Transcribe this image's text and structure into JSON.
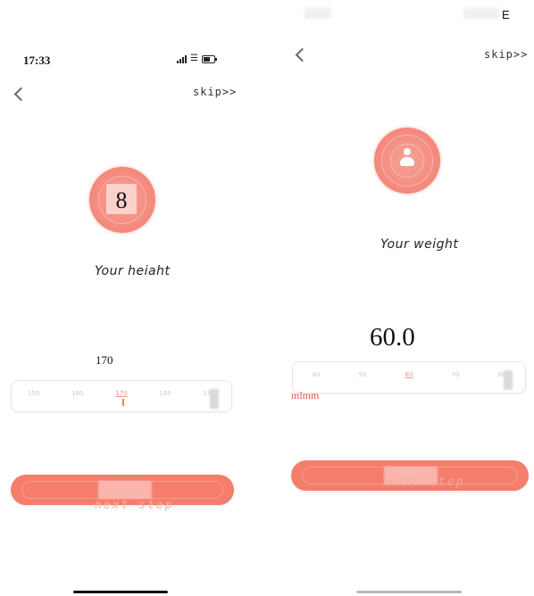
{
  "colors": {
    "accent": "#f47d6b",
    "accent_light": "#f6a49a",
    "unit_text": "#e9574a"
  },
  "left": {
    "status_bar": {
      "time": "17:33",
      "icons": [
        "signal-icon",
        "wifi-icon",
        "battery-icon"
      ]
    },
    "nav": {
      "back_icon": "chevron-left-icon",
      "skip_label": "skip>>"
    },
    "avatar_glyph": "8",
    "title": "Your heiaht",
    "value": "170",
    "ruler": {
      "ticks": [
        "150",
        "160",
        "170",
        "180",
        "190"
      ],
      "selected_index": 2
    },
    "button_label": "next step"
  },
  "right": {
    "top_letter": "E",
    "nav": {
      "back_icon": "chevron-left-icon",
      "skip_label": "skip>>"
    },
    "avatar_icon": "person-icon",
    "title": "Your weight",
    "value": "60.0",
    "unit_label": "mlmm",
    "ruler": {
      "ticks": [
        "40",
        "50",
        "60",
        "70",
        "80"
      ],
      "selected_index": 2
    },
    "button_label": "next step"
  }
}
